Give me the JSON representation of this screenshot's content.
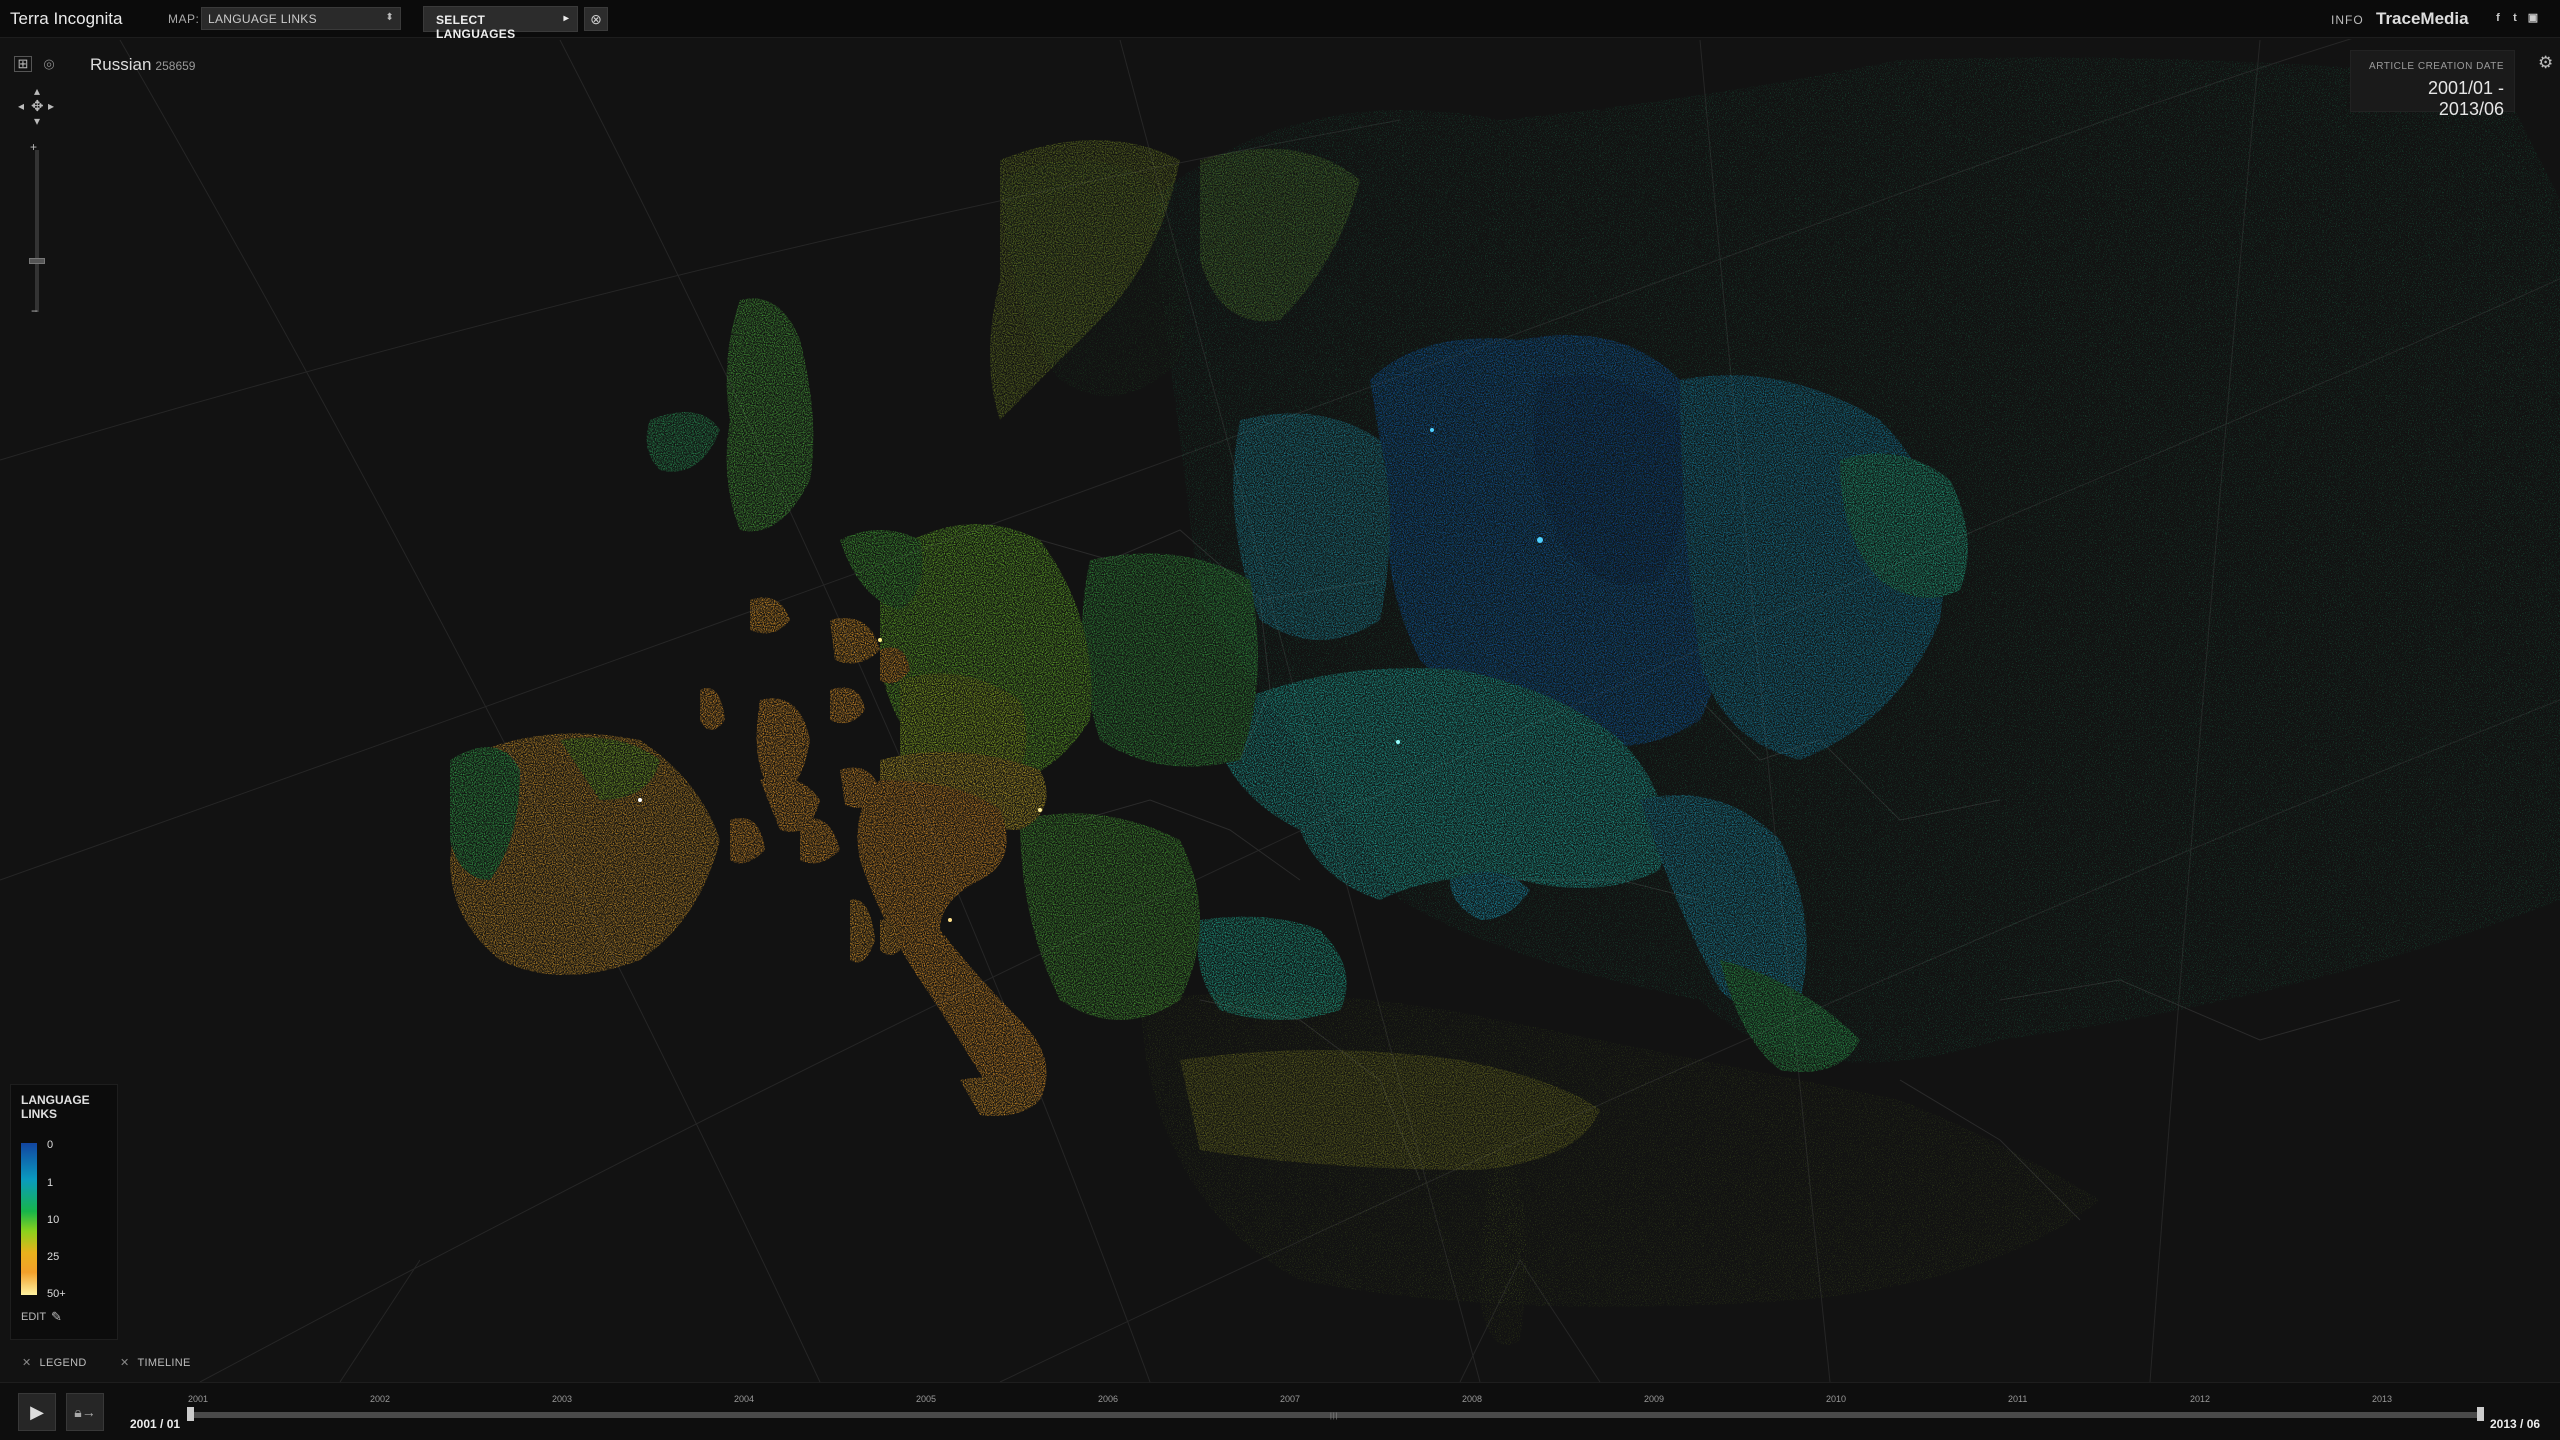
{
  "app": {
    "title": "Terra Incognita"
  },
  "header": {
    "map_label": "MAP:",
    "map_select_value": "LANGUAGE LINKS",
    "select_languages_label": "SELECT LANGUAGES",
    "info_label": "INFO",
    "brand": "TraceMedia",
    "social_icons": [
      "facebook-icon",
      "twitter-icon",
      "share-icon"
    ]
  },
  "map": {
    "language": "Russian",
    "article_count": "258659",
    "date_panel": {
      "label": "ARTICLE CREATION DATE",
      "value": "2001/01 - 2013/06"
    }
  },
  "legend": {
    "title": "LANGUAGE LINKS",
    "ticks": [
      "0",
      "1",
      "10",
      "25",
      "50+"
    ],
    "edit_label": "EDIT",
    "gradient_colors": [
      "#1245a0",
      "#0a9abf",
      "#17b54a",
      "#8bd21c",
      "#e8b21c",
      "#fff2a0"
    ]
  },
  "toggles": {
    "legend_label": "LEGEND",
    "timeline_label": "TIMELINE"
  },
  "timeline": {
    "start_label": "2001 / 01",
    "end_label": "2013 / 06",
    "years": [
      "2001",
      "2002",
      "2003",
      "2004",
      "2005",
      "2006",
      "2007",
      "2008",
      "2009",
      "2010",
      "2011",
      "2012",
      "2013"
    ]
  }
}
